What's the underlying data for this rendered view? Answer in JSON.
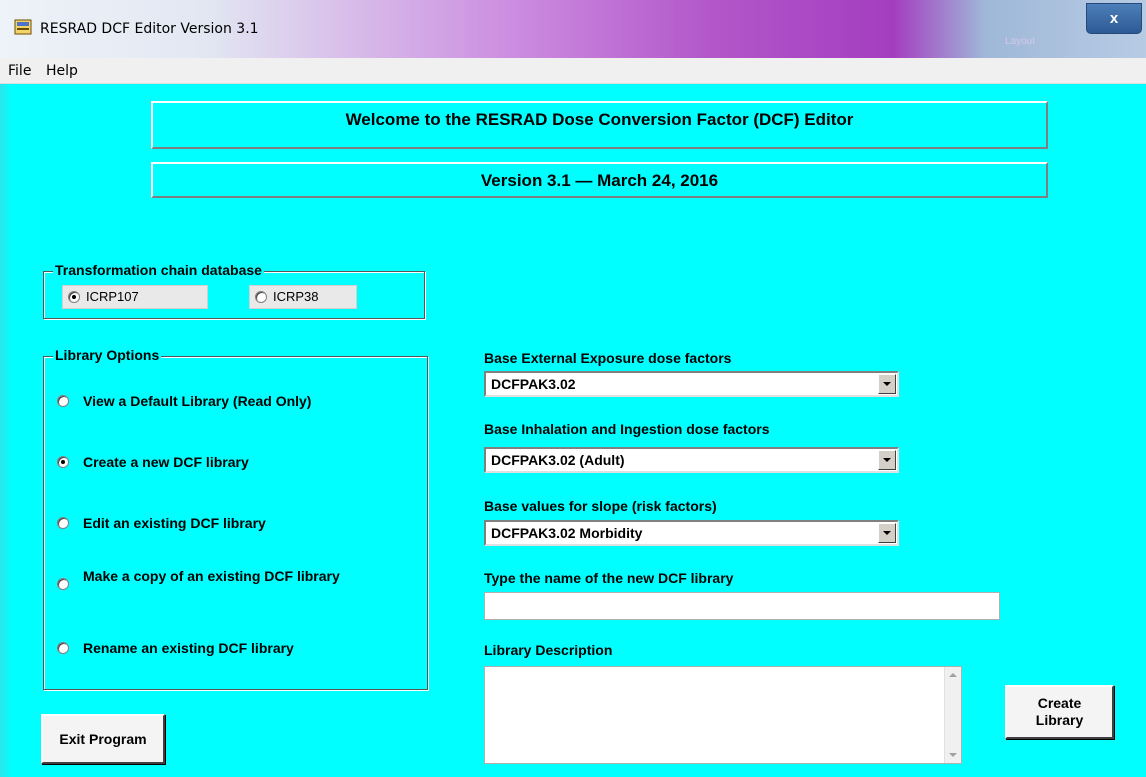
{
  "window": {
    "title": "RESRAD DCF Editor Version 3.1",
    "close_label": "x",
    "ghost_label": "Layout"
  },
  "menu": [
    "File",
    "Help"
  ],
  "banner": {
    "welcome": "Welcome to the RESRAD Dose Conversion Factor (DCF) Editor",
    "version": "Version 3.1 — March 24, 2016"
  },
  "transformation": {
    "label": "Transformation chain database",
    "options": [
      {
        "label": "ICRP107",
        "selected": true
      },
      {
        "label": "ICRP38",
        "selected": false
      }
    ]
  },
  "library_options": {
    "label": "Library Options",
    "options": [
      {
        "label": "View a Default Library (Read Only)",
        "selected": false
      },
      {
        "label": "Create a new DCF library",
        "selected": true
      },
      {
        "label": "Edit an existing DCF library",
        "selected": false
      },
      {
        "label": "Make a copy of an existing DCF library",
        "selected": false
      },
      {
        "label": "Rename an existing DCF library",
        "selected": false
      }
    ]
  },
  "fields": {
    "external_label": "Base External Exposure  dose factors",
    "external_value": "DCFPAK3.02",
    "inhalation_label": "Base Inhalation and Ingestion  dose factors",
    "inhalation_value": "DCFPAK3.02 (Adult)",
    "slope_label": "Base values for slope (risk factors)",
    "slope_value": "DCFPAK3.02 Morbidity",
    "name_label": "Type the name of the new DCF library",
    "name_value": "",
    "description_label": "Library Description",
    "description_value": ""
  },
  "buttons": {
    "exit": "Exit Program",
    "create": "Create Library"
  },
  "colors": {
    "background": "#00ffff",
    "accent_title": "#a43ec0"
  }
}
